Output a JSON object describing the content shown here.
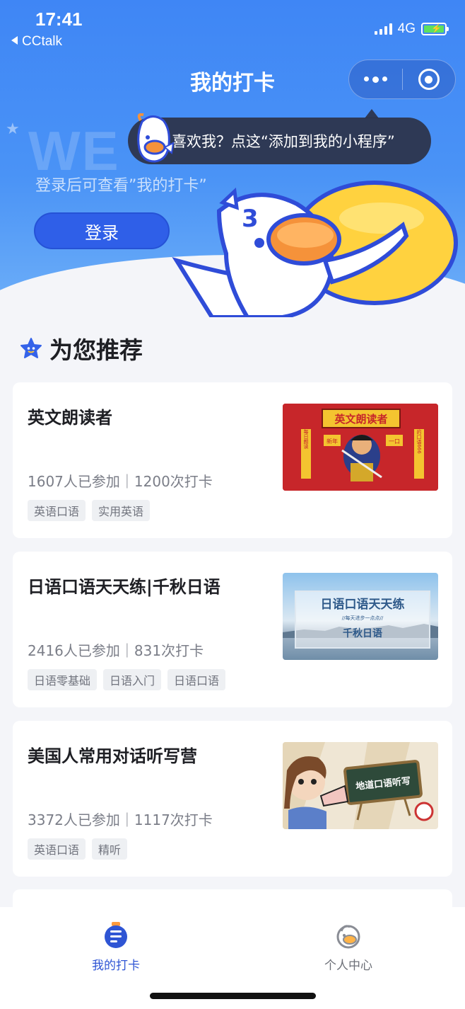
{
  "status_bar": {
    "time": "17:41",
    "back_app": "CCtalk",
    "network": "4G"
  },
  "header": {
    "title": "我的打卡"
  },
  "tooltip": {
    "text": "喜欢我？点这“添加到我的小程序”"
  },
  "hero": {
    "watermark": "WE",
    "login_hint": "登录后可查看”我的打卡”",
    "login_button": "登录"
  },
  "section": {
    "title": "为您推荐"
  },
  "cards": [
    {
      "name": "英文朗读者",
      "stats": "1607人已参加｜1200次打卡",
      "tags": [
        "英语口语",
        "实用英语"
      ],
      "thumb_title": "英文朗读者",
      "thumb_left": "每日朗读",
      "thumb_right": "年的口语666",
      "thumb_badge_l": "新年",
      "thumb_badge_r": "一口"
    },
    {
      "name": "日语口语天天练|千秋日语",
      "stats": "2416人已参加｜831次打卡",
      "tags": [
        "日语零基础",
        "日语入门",
        "日语口语"
      ],
      "thumb_title": "日语口语天天练",
      "thumb_sub": "//每天进步一点点//",
      "thumb_brand": "千秋日语"
    },
    {
      "name": "美国人常用对话听写营",
      "stats": "3372人已参加｜1117次打卡",
      "tags": [
        "英语口语",
        "精听"
      ],
      "thumb_board": "地道口语听写"
    }
  ],
  "tabbar": {
    "tabs": [
      {
        "label": "我的打卡",
        "active": true
      },
      {
        "label": "个人中心",
        "active": false
      }
    ]
  },
  "colors": {
    "primary": "#3f86f5",
    "accent": "#2f5fe8",
    "active_tab": "#2f55d4",
    "inactive_tab": "#6d7078"
  }
}
